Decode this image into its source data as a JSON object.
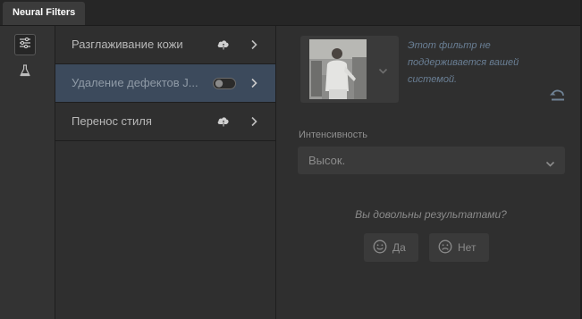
{
  "window": {
    "tab_title": "Neural Filters"
  },
  "rail": {
    "items": [
      {
        "icon": "sliders-icon",
        "active": true
      },
      {
        "icon": "flask-icon",
        "active": false
      }
    ]
  },
  "filters": [
    {
      "label": "Разглаживание кожи",
      "status_icon": "cloud-download-icon",
      "selected": false
    },
    {
      "label": "Удаление дефектов J...",
      "status_icon": "toggle-switch",
      "toggle_on": false,
      "selected": true
    },
    {
      "label": "Перенос стиля",
      "status_icon": "cloud-download-icon",
      "selected": false
    }
  ],
  "detail": {
    "unsupported_note": "Этот фильтр не поддерживается вашей системой.",
    "intensity_label": "Интенсивность",
    "intensity_value": "Высок.",
    "feedback_question": "Вы довольны результатами?",
    "yes_label": "Да",
    "no_label": "Нет"
  },
  "colors": {
    "background": "#2f2f2f",
    "selected_row": "#3c4a5c",
    "note_text": "#6a7f95"
  }
}
